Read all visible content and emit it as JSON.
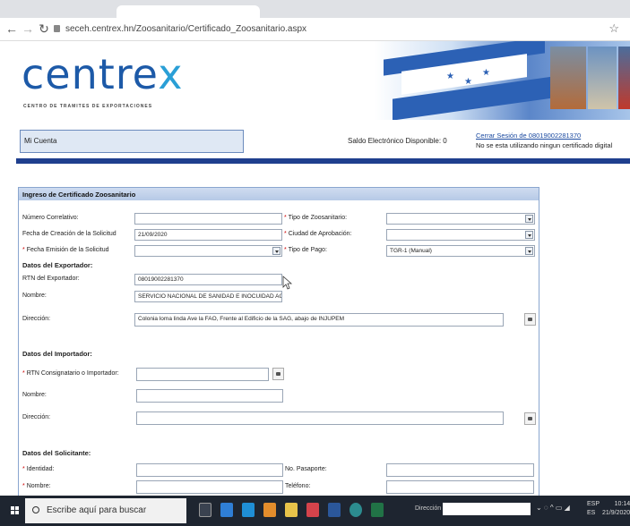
{
  "browser": {
    "url": "seceh.centrex.hn/Zoosanitario/Certificado_Zoosanitario.aspx"
  },
  "header": {
    "logo_main": "centre",
    "logo_x": "x",
    "logo_sub": "CENTRO DE TRAMITES DE EXPORTACIONES"
  },
  "account": {
    "mi_cuenta": "Mi Cuenta",
    "saldo": "Saldo Electrónico Disponible: 0",
    "logout": "Cerrar Sesión de 08019002281370",
    "cert_status": "No se esta utilizando ningun certificado digital"
  },
  "form": {
    "title": "Ingreso de Certificado Zoosanitario",
    "numero_correlativo_label": "Número Correlativo:",
    "numero_correlativo": "",
    "fecha_creacion_label": "Fecha de Creación de la Solicitud",
    "fecha_creacion": "21/09/2020",
    "fecha_emision_label": "Fecha Emisión de la Solicitud",
    "fecha_emision": "",
    "tipo_zoo_label": "Tipo de Zoosanitario:",
    "tipo_zoo": "",
    "ciudad_label": "Ciudad de Aprobación:",
    "ciudad": "",
    "tipo_pago_label": "Tipo de Pago:",
    "tipo_pago": "TGR-1 (Manual)",
    "exportador_heading": "Datos del Exportador:",
    "rtn_exportador_label": "RTN del Exportador:",
    "rtn_exportador": "08019002281370",
    "nombre_label": "Nombre:",
    "nombre_exportador": "SERVICIO NACIONAL DE SANIDAD E INOCUIDAD AGROA",
    "direccion_label": "Dirección:",
    "direccion_exportador": "Colonia loma linda Ave la FAO, Frente al Edificio de la SAG, abajo de INJUPEM",
    "importador_heading": "Datos del Importador:",
    "rtn_importador_label": "RTN Consignatario o Importador:",
    "rtn_importador": "",
    "nombre_importador_label": "Nombre:",
    "nombre_importador": "",
    "direccion_importador_label": "Dirección:",
    "direccion_importador": "",
    "solicitante_heading": "Datos del Solicitante:",
    "identidad_label": "Identidad:",
    "identidad": "",
    "pasaporte_label": "No. Pasaporte:",
    "pasaporte": "",
    "nombre_solicitante_label": "Nombre:",
    "nombre_solicitante": "",
    "telefono_label": "Teléfono:",
    "telefono": "",
    "required_mark": "*"
  },
  "taskbar": {
    "search_placeholder": "Escribe aquí para buscar",
    "address_label": "Dirección",
    "lang1": "ESP",
    "lang2": "ES",
    "time": "10:14",
    "date": "21/9/2020"
  }
}
